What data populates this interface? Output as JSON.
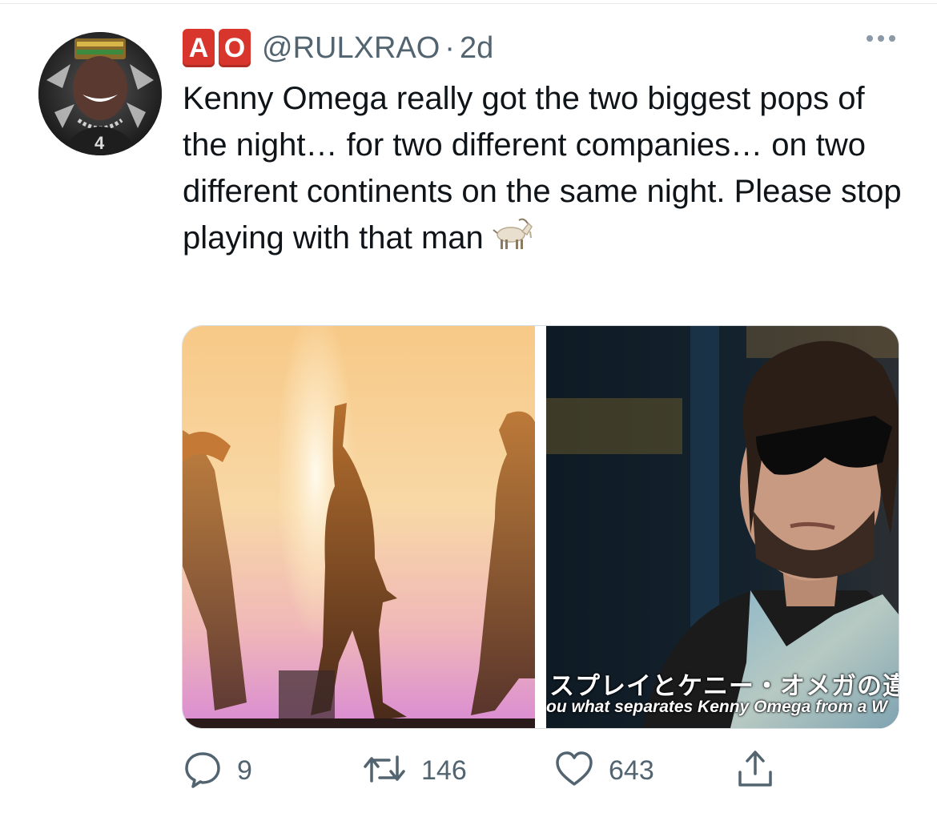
{
  "tweet": {
    "badges": [
      "A",
      "O"
    ],
    "handle": "@RULXRAO",
    "separator": "·",
    "time": "2d",
    "text": "Kenny Omega really got the two biggest pops of the night… for two different companies… on two different continents on the same night. Please stop playing with that man",
    "emoji": "goat-emoji"
  },
  "media": {
    "left_image": "silhouettes-pyro-stage",
    "right_image": "man-sunglasses-interview",
    "subtitle_jp": "スプレイとケニー・オメガの違い",
    "subtitle_en": "ou what separates Kenny Omega from a W"
  },
  "actions": {
    "reply_count": "9",
    "retweet_count": "146",
    "like_count": "643"
  },
  "colors": {
    "badge": "#d8362c",
    "secondary_text": "#536471",
    "primary_text": "#0f1419"
  }
}
